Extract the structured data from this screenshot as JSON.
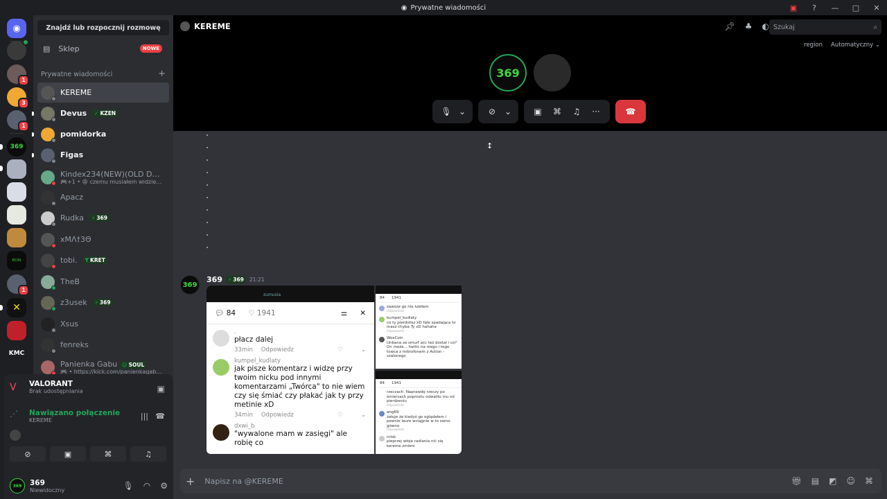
{
  "window": {
    "title": "Prywatne wiadomości"
  },
  "sidebar": {
    "search_label": "Znajdź lub rozpocznij rozmowę",
    "shop_label": "Sklep",
    "shop_badge": "NOWE",
    "dm_header": "Prywatne wiadomości",
    "dms": [
      {
        "name": "KEREME",
        "selected": true
      },
      {
        "name": "Devus",
        "tag": "KZEN",
        "bold": true
      },
      {
        "name": "pomidorka",
        "bold": true
      },
      {
        "name": "Figas",
        "bold": true
      },
      {
        "name": "Kindex234(NEW)(OLD DELET...",
        "sub": "🎮+1 • 😩 czemu musiałem widzieć typa ..."
      },
      {
        "name": "Apacz"
      },
      {
        "name": "Rudka",
        "tag": "369"
      },
      {
        "name": "xMΛ†3Θ"
      },
      {
        "name": "tobi.",
        "tag": "KRET"
      },
      {
        "name": "TheB"
      },
      {
        "name": "z3usek",
        "tag": "369"
      },
      {
        "name": "Xsus"
      },
      {
        "name": "fenreks"
      },
      {
        "name": "Panienka Gabu",
        "tag": "SOUL",
        "sub": "🎮 • https://kick.com/panienkagabu <3"
      }
    ],
    "guild_badges": [
      "1",
      "3",
      "1",
      "1"
    ],
    "guild_text_kmc": "KMC"
  },
  "voice_panel": {
    "game_title": "VALORANT",
    "game_status": "Brak udostępniania",
    "connection_title": "Nawiązano połączenie",
    "connection_channel": "KEREME"
  },
  "user_panel": {
    "name": "369",
    "status": "Niewidoczny"
  },
  "channel": {
    "name": "KEREME",
    "search_placeholder": "Szukaj",
    "region_label": "region",
    "region_value": "Automatyczny"
  },
  "call": {
    "avatar1_text": "369"
  },
  "message": {
    "author": "369",
    "author_tag": "369",
    "time": "21:21"
  },
  "image_main": {
    "top_text": "zumusia",
    "comments_count": "84",
    "likes_count": "1941",
    "comments": [
      {
        "user": ".",
        "text": "płacz dalej",
        "time": "33min",
        "reply": "Odpowiedz"
      },
      {
        "user": "kumpel_kudlaty",
        "text": "jak pisze komentarz i widzę przy twoim nicku pod innymi komentarzami „Twórca\" to nie wiem czy się śmiać czy płakać jak ty przy metinie xD",
        "time": "34min",
        "reply": "Odpowiedz"
      },
      {
        "user": "dxwi_b",
        "text": "\"wywalone mam w zasięgi\" ale robię co",
        "time": "",
        "reply": ""
      }
    ]
  },
  "image_small1": {
    "count": "84",
    "likes": "1941",
    "comments": [
      {
        "user": "",
        "text": "zawsze go nie lubiłem",
        "reply": "Odpowiedz"
      },
      {
        "user": "kumpel_kudlaty",
        "text": "co ty pierdolisz xD fale spadająca to masz chyba Ty xD hahaha",
        "reply": "Odpowiedz"
      },
      {
        "user": "WoxCoin",
        "text": "Unbana za smurf acc też dostał i co? On może... hattic na niego i tego towca z mikrofonem z Action - szalonego",
        "reply": ""
      }
    ]
  },
  "image_small2": {
    "count": "84",
    "likes": "1941",
    "comments": [
      {
        "user": "",
        "text": "rzeczach. Naprawdę rzeczy po śmiersach poprostu odwaliło mu od pierdzeniu",
        "reply": "Odpowiedz"
      },
      {
        "user": "ang69",
        "text": "żałuje że kiedyś go oglądałem i pewnie laure wciągnie w to samo gówno",
        "reply": "Odpowiedz"
      },
      {
        "user": "nrisk",
        "text": "pieprzej włoje radiania nić się kereme zmieni",
        "reply": ""
      }
    ]
  },
  "composer": {
    "placeholder": "Napisz na @KEREME"
  },
  "colors": {
    "accent": "#5865f2",
    "danger": "#da373c",
    "online": "#23a55a",
    "dnd": "#f23f43"
  }
}
